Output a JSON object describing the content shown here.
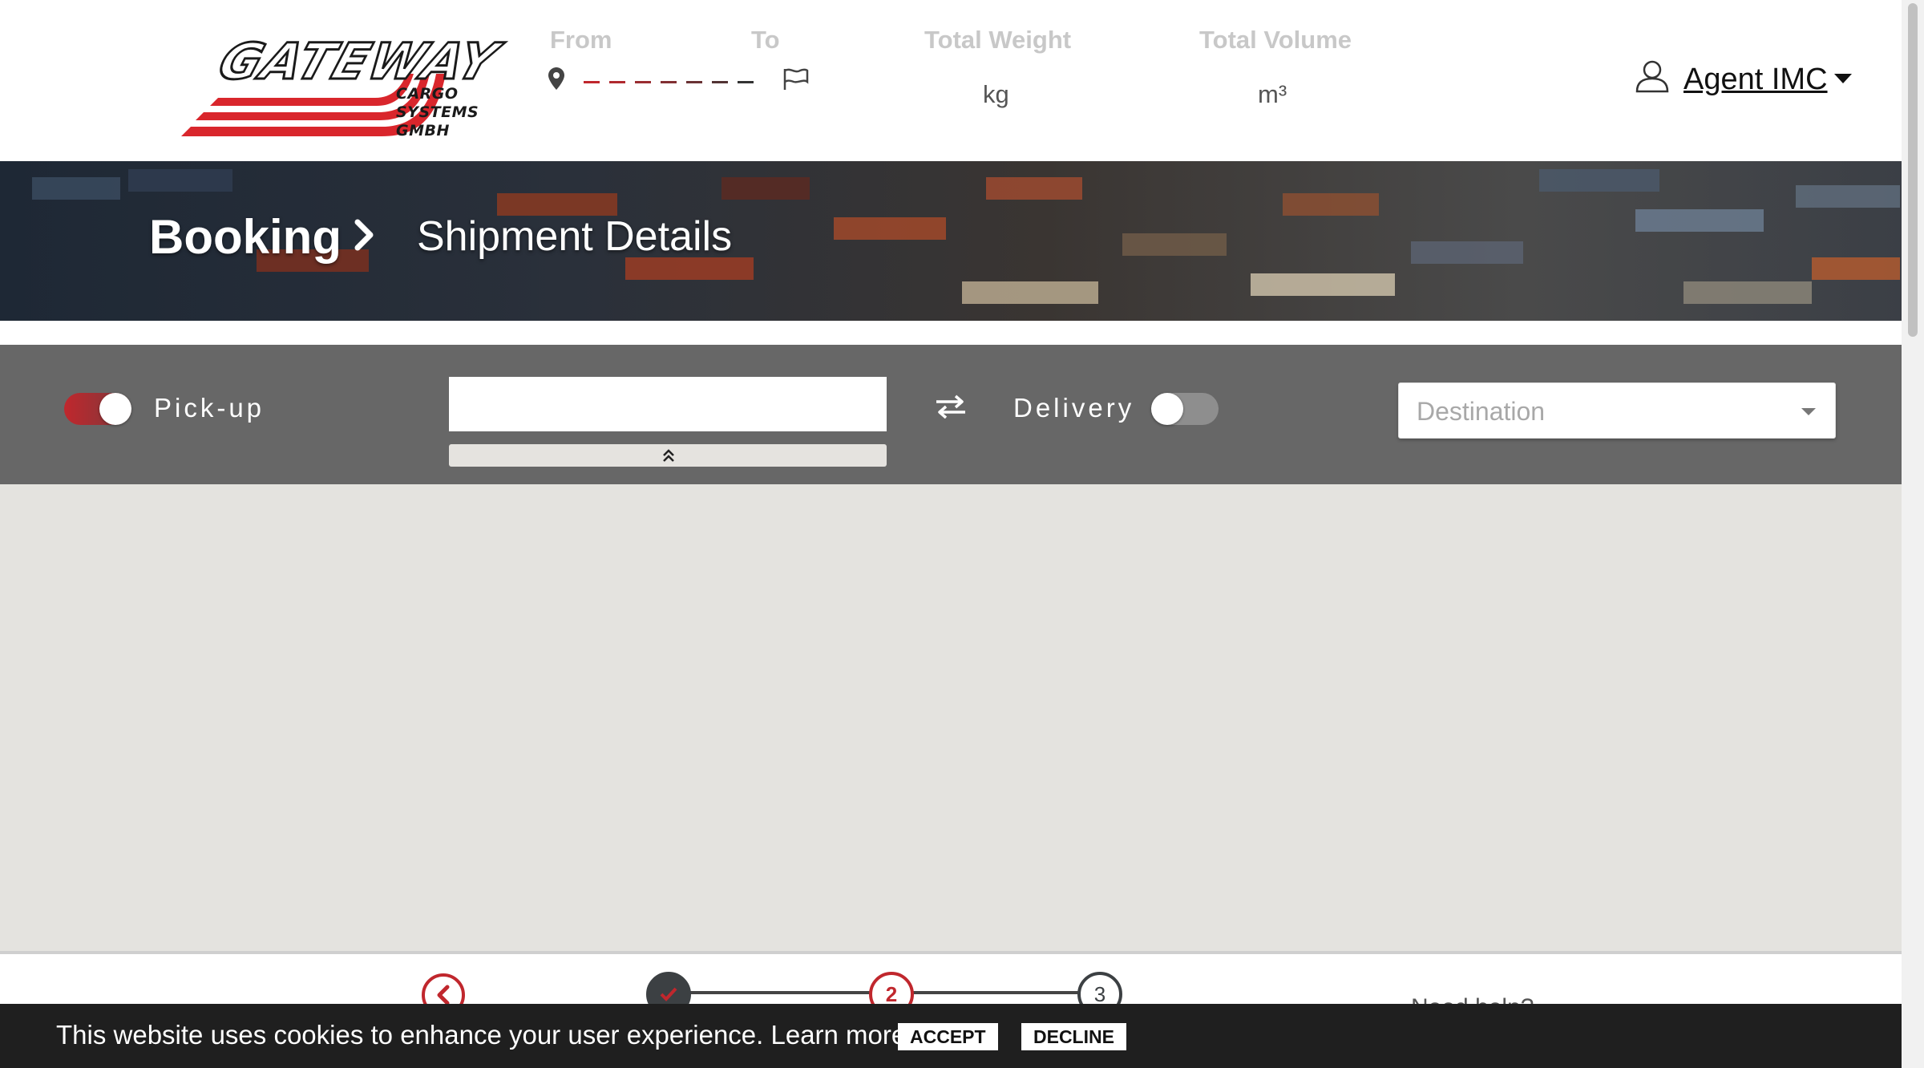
{
  "header": {
    "logo": {
      "word": "GATEWAY",
      "sub_line1": "CARGO",
      "sub_line2": "SYSTEMS GMBH"
    },
    "from_label": "From",
    "to_label": "To",
    "total_weight_label": "Total Weight",
    "total_weight_unit": "kg",
    "total_volume_label": "Total Volume",
    "total_volume_unit": "m³",
    "user_name": "Agent IMC"
  },
  "banner": {
    "title": "Booking",
    "subtitle": "Shipment Details"
  },
  "filter": {
    "pickup_label": "Pick-up",
    "pickup_enabled": true,
    "address_value": "",
    "delivery_label": "Delivery",
    "delivery_enabled": false,
    "destination_placeholder": "Destination"
  },
  "stepper": {
    "steps": [
      {
        "label": "",
        "state": "done"
      },
      {
        "label": "2",
        "state": "active"
      },
      {
        "label": "3",
        "state": "pending"
      }
    ],
    "help_text": "Need help?"
  },
  "cookie": {
    "message": "This website uses cookies to enhance your user experience. Learn more",
    "accept_label": "ACCEPT",
    "decline_label": "DECLINE"
  },
  "colors": {
    "brand_red": "#c0272d",
    "filter_bg": "#676767",
    "map_bg": "#e4e3df"
  }
}
